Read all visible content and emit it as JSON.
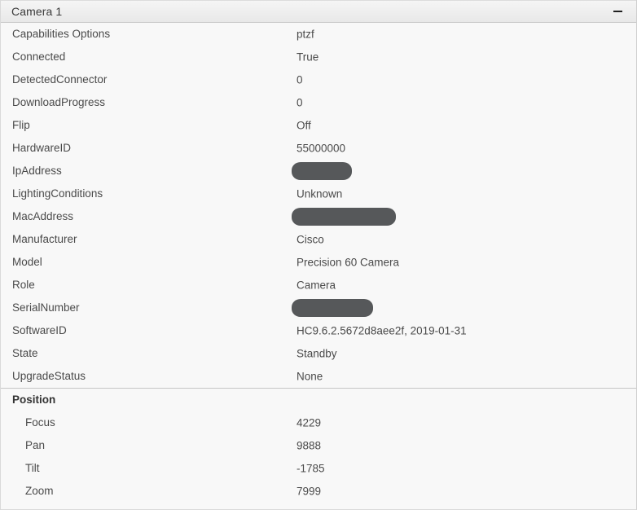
{
  "header": {
    "title": "Camera 1",
    "minimize_icon": "minimize-icon",
    "minimize_label": "—"
  },
  "properties": [
    {
      "label": "Capabilities Options",
      "value": "ptzf",
      "redacted": false,
      "indent": false,
      "group": false
    },
    {
      "label": "Connected",
      "value": "True",
      "redacted": false,
      "indent": false,
      "group": false
    },
    {
      "label": "DetectedConnector",
      "value": "0",
      "redacted": false,
      "indent": false,
      "group": false
    },
    {
      "label": "DownloadProgress",
      "value": "0",
      "redacted": false,
      "indent": false,
      "group": false
    },
    {
      "label": "Flip",
      "value": "Off",
      "redacted": false,
      "indent": false,
      "group": false
    },
    {
      "label": "HardwareID",
      "value": "55000000",
      "redacted": false,
      "indent": false,
      "group": false
    },
    {
      "label": "IpAddress",
      "value": "",
      "redacted": true,
      "redaction_size": "ip",
      "indent": false,
      "group": false
    },
    {
      "label": "LightingConditions",
      "value": "Unknown",
      "redacted": false,
      "indent": false,
      "group": false
    },
    {
      "label": "MacAddress",
      "value": "",
      "redacted": true,
      "redaction_size": "mac",
      "indent": false,
      "group": false
    },
    {
      "label": "Manufacturer",
      "value": "Cisco",
      "redacted": false,
      "indent": false,
      "group": false
    },
    {
      "label": "Model",
      "value": "Precision 60 Camera",
      "redacted": false,
      "indent": false,
      "group": false
    },
    {
      "label": "Role",
      "value": "Camera",
      "redacted": false,
      "indent": false,
      "group": false
    },
    {
      "label": "SerialNumber",
      "value": "",
      "redacted": true,
      "redaction_size": "sern",
      "indent": false,
      "group": false
    },
    {
      "label": "SoftwareID",
      "value": "HC9.6.2.5672d8aee2f, 2019-01-31",
      "redacted": false,
      "indent": false,
      "group": false
    },
    {
      "label": "State",
      "value": "Standby",
      "redacted": false,
      "indent": false,
      "group": false
    },
    {
      "label": "UpgradeStatus",
      "value": "None",
      "redacted": false,
      "indent": false,
      "group": false
    },
    {
      "label": "Position",
      "value": "",
      "redacted": false,
      "indent": false,
      "group": true,
      "divider_above": true
    },
    {
      "label": "Focus",
      "value": "4229",
      "redacted": false,
      "indent": true,
      "group": false
    },
    {
      "label": "Pan",
      "value": "9888",
      "redacted": false,
      "indent": true,
      "group": false
    },
    {
      "label": "Tilt",
      "value": "-1785",
      "redacted": false,
      "indent": true,
      "group": false
    },
    {
      "label": "Zoom",
      "value": "7999",
      "redacted": false,
      "indent": true,
      "group": false
    }
  ],
  "colors": {
    "panel_background": "#f8f8f8",
    "header_background": "#eeeeee",
    "label_text": "#4a4a4a",
    "value_text": "#4a4a4a",
    "redaction": "#56585a",
    "divider": "#c6c6c6"
  }
}
